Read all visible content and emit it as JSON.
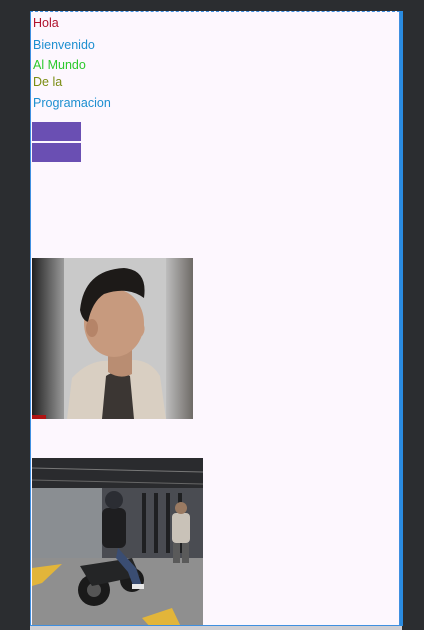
{
  "texts": {
    "line1": "Hola",
    "line2": "Bienvenido",
    "line3": "Al Mundo",
    "line4": "De la",
    "line5": "Programacion"
  },
  "colors": {
    "line1": "#b0122e",
    "line2": "#1d8fd0",
    "line3": "#2cc92c",
    "line4": "#7a8c12",
    "line5": "#1d8fd0",
    "button": "#6a4fb3",
    "screen_background": "#fdf7fe",
    "editor_background": "#2b2d30",
    "selection_border": "#3f8fe0"
  },
  "buttons": [
    {
      "label": ""
    },
    {
      "label": ""
    }
  ],
  "images": [
    {
      "name": "portrait-photo",
      "description_icon": "person-photo"
    },
    {
      "name": "motorcycle-photo",
      "description_icon": "motorcycle-photo"
    }
  ]
}
